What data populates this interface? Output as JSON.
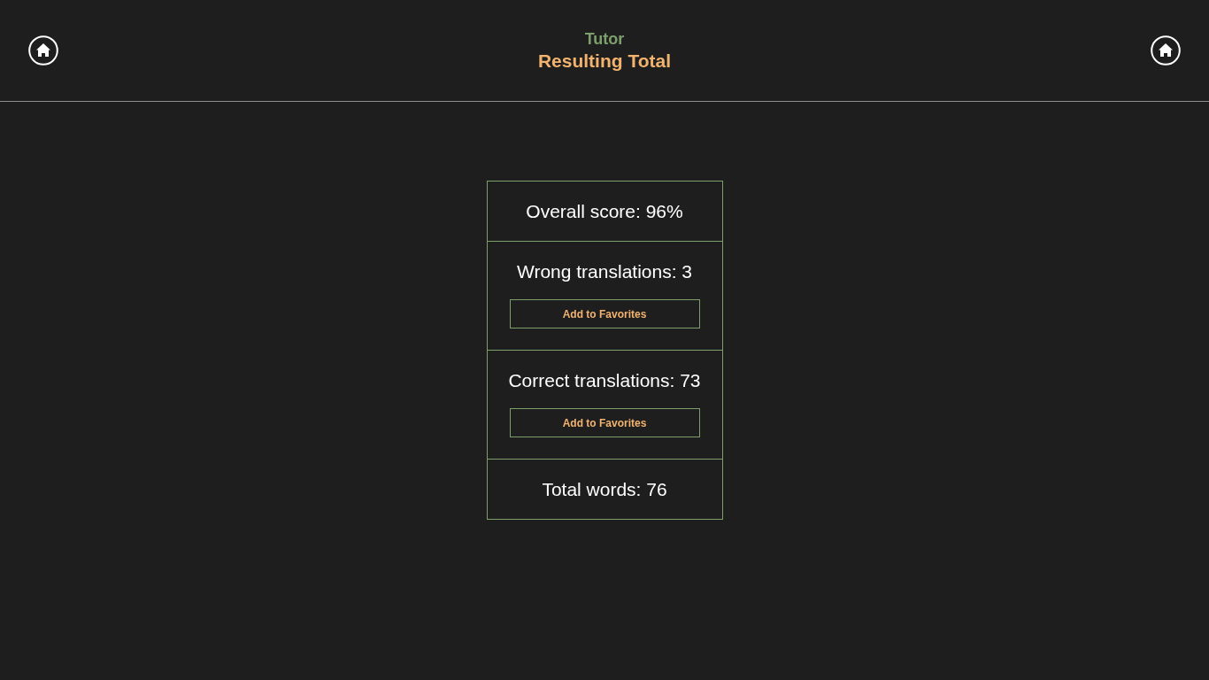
{
  "header": {
    "app_title": "Tutor",
    "page_title": "Resulting Total"
  },
  "results": [
    {
      "kind": "stat",
      "label": "Overall score: 96%"
    },
    {
      "kind": "action",
      "label": "Wrong translations: 3",
      "button": "Add to Favorites"
    },
    {
      "kind": "action",
      "label": "Correct translations: 73",
      "button": "Add to Favorites"
    },
    {
      "kind": "stat",
      "label": "Total words: 76"
    }
  ]
}
